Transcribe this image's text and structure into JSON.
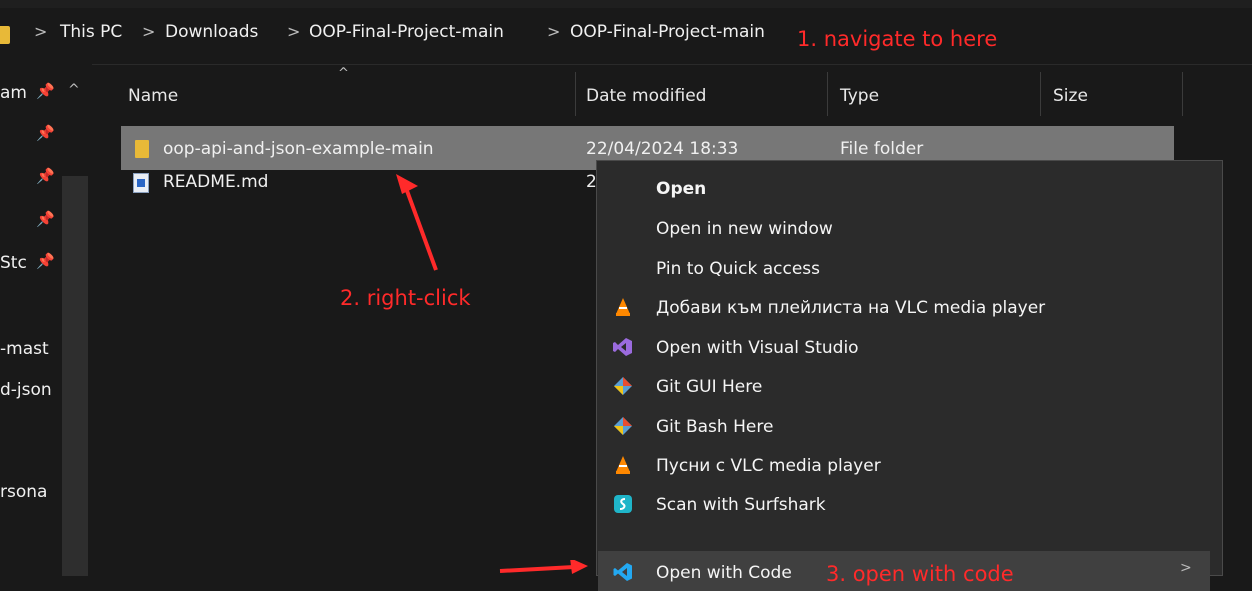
{
  "breadcrumb": {
    "items": [
      "This PC",
      "Downloads",
      "OOP-Final-Project-main",
      "OOP-Final-Project-main"
    ],
    "separator": ">"
  },
  "annotations": {
    "step1": "1. navigate to here",
    "step2": "2. right-click",
    "step3": "3. open with code"
  },
  "nav": {
    "items": [
      "am",
      "Stc",
      "-mast",
      "d-json",
      "rsona"
    ],
    "sort_indicator": "^"
  },
  "columns": {
    "name": "Name",
    "date": "Date modified",
    "type": "Type",
    "size": "Size",
    "sort_arrow": "^"
  },
  "files": [
    {
      "name": "oop-api-and-json-example-main",
      "date": "22/04/2024 18:33",
      "type": "File folder",
      "icon": "folder-icon"
    },
    {
      "name": "README.md",
      "date": "2",
      "type": "",
      "icon": "markdown-file-icon"
    }
  ],
  "context_menu": {
    "items": [
      {
        "label": "Open",
        "icon": ""
      },
      {
        "label": "Open in new window",
        "icon": ""
      },
      {
        "label": "Pin to Quick access",
        "icon": ""
      },
      {
        "label": "Добави към плейлиста на VLC media player",
        "icon": "vlc-icon"
      },
      {
        "label": "Open with Visual Studio",
        "icon": "visual-studio-icon"
      },
      {
        "label": "Git GUI Here",
        "icon": "git-icon"
      },
      {
        "label": "Git Bash Here",
        "icon": "git-icon"
      },
      {
        "label": "Пусни с VLC media player",
        "icon": "vlc-icon"
      },
      {
        "label": "Scan with Surfshark",
        "icon": "surfshark-icon"
      },
      {
        "label": "Open with Code",
        "icon": "vscode-icon"
      }
    ],
    "more_arrow": ">"
  },
  "colors": {
    "background": "#191919",
    "selected_row": "#777777",
    "menu_bg": "#2b2b2b",
    "menu_hover": "#404040",
    "annotation": "#ff2a2a",
    "folder": "#e8b938"
  }
}
